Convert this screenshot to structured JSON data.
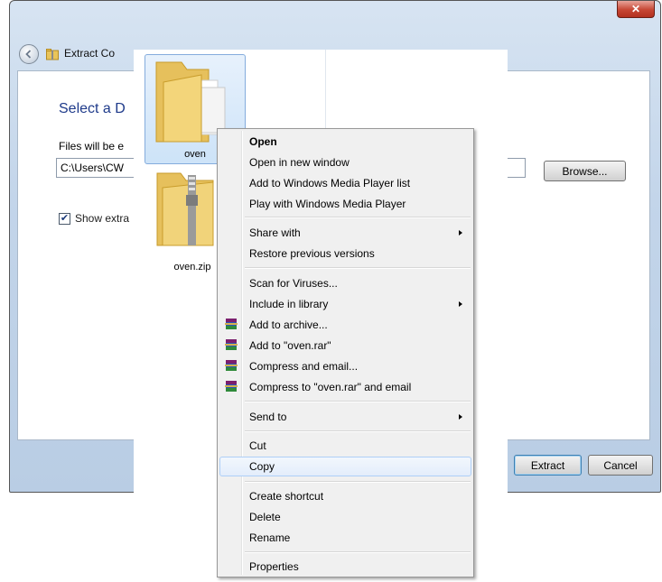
{
  "dialog": {
    "title": "Extract Co",
    "heading": "Select a D",
    "dest_label": "Files will be e",
    "path_value": "C:\\Users\\CW",
    "browse_label": "Browse...",
    "checkbox_label": "Show extra",
    "checkbox_checked": true,
    "extract_label": "Extract",
    "cancel_label": "Cancel"
  },
  "files": {
    "folder_name": "oven",
    "zip_name": "oven.zip"
  },
  "menu": {
    "items": [
      {
        "label": "Open",
        "bold": true
      },
      {
        "label": "Open in new window"
      },
      {
        "label": "Add to Windows Media Player list"
      },
      {
        "label": "Play with Windows Media Player"
      },
      {
        "label": "Share with",
        "submenu": true
      },
      {
        "label": "Restore previous versions"
      },
      {
        "label": "Scan for Viruses..."
      },
      {
        "label": "Include in library",
        "submenu": true
      },
      {
        "label": "Add to archive...",
        "icon": "winrar-icon"
      },
      {
        "label": "Add to \"oven.rar\"",
        "icon": "winrar-icon"
      },
      {
        "label": "Compress and email...",
        "icon": "winrar-icon"
      },
      {
        "label": "Compress to \"oven.rar\" and email",
        "icon": "winrar-icon"
      },
      {
        "label": "Send to",
        "submenu": true
      },
      {
        "label": "Cut"
      },
      {
        "label": "Copy",
        "hovered": true
      },
      {
        "label": "Create shortcut"
      },
      {
        "label": "Delete"
      },
      {
        "label": "Rename"
      },
      {
        "label": "Properties"
      }
    ]
  },
  "colors": {
    "heading": "#1e3a8a",
    "close_button": "#c64633",
    "menu_hover_border": "#aecff7"
  }
}
